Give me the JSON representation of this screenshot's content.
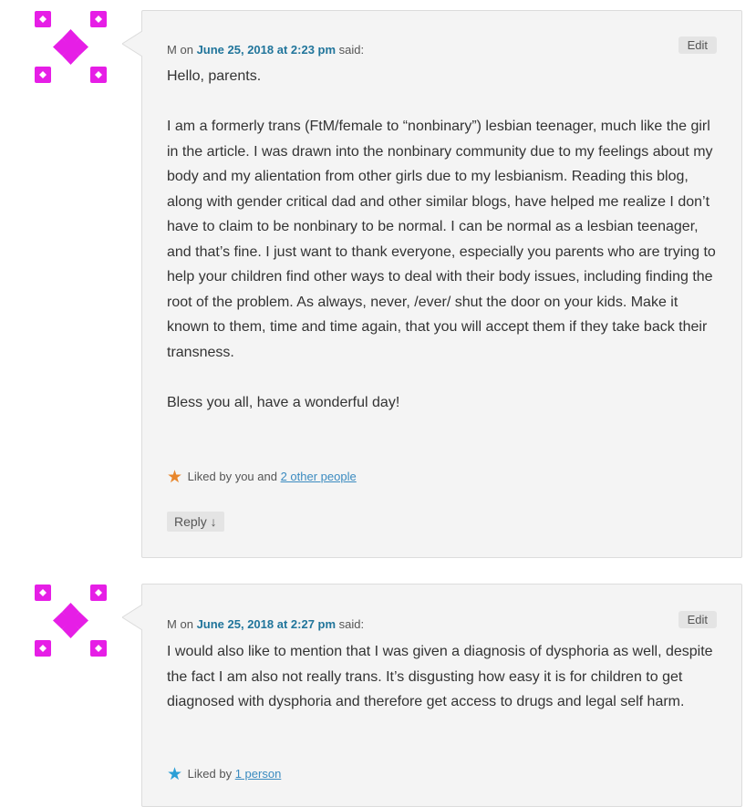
{
  "comments": [
    {
      "author": "M",
      "on": "on",
      "date": "June 25, 2018 at 2:23 pm",
      "said": "said:",
      "edit_label": "Edit",
      "paragraphs": [
        "Hello, parents.",
        "I am a formerly trans (FtM/female to “nonbinary”) lesbian teenager, much like the girl in the article. I was drawn into the nonbinary community due to my feelings about my body and my alientation from other girls due to my lesbianism. Reading this blog, along with gender critical dad and other similar blogs, have helped me realize I don’t have to claim to be nonbinary to be normal. I can be normal as a lesbian teenager, and that’s fine. I just want to thank everyone, especially you parents who are trying to help your children find other ways to deal with their body issues, including finding the root of the problem. As always, never, /ever/ shut the door on your kids. Make it known to them, time and time again, that you will accept them if they take back their transness.",
        "Bless you all, have a wonderful day!"
      ],
      "likes_prefix": "Liked by you and",
      "likes_link": "2 other people",
      "star_color": "#e8862b",
      "reply_label": "Reply ↓"
    },
    {
      "author": "M",
      "on": "on",
      "date": "June 25, 2018 at 2:27 pm",
      "said": "said:",
      "edit_label": "Edit",
      "paragraphs": [
        "I would also like to mention that I was given a diagnosis of dysphoria as well, despite the fact I am also not really trans. It’s disgusting how easy it is for children to get diagnosed with dysphoria and therefore get access to drugs and legal self harm."
      ],
      "likes_prefix": "Liked by",
      "likes_link": "1 person",
      "star_color": "#2a9fd6"
    }
  ],
  "avatar_color": "#e61ee6",
  "link_color": "#21759b"
}
